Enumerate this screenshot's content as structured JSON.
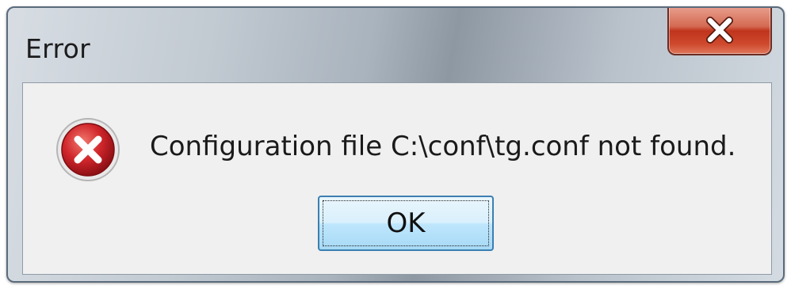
{
  "window": {
    "title": "Error"
  },
  "dialog": {
    "icon": "error-icon",
    "message": "Configuration file C:\\conf\\tg.conf not found.",
    "ok_label": "OK"
  },
  "colors": {
    "close_button": "#c0341c",
    "error_icon": "#c8202a",
    "ok_border": "#3c7fb1",
    "content_bg": "#f0f0f0"
  }
}
